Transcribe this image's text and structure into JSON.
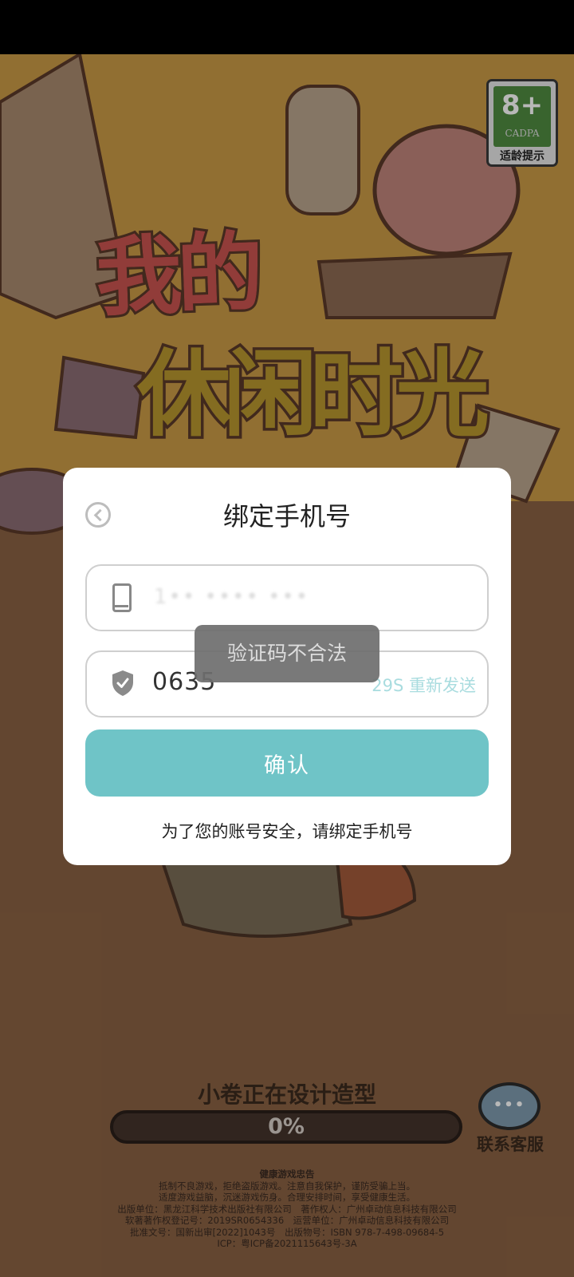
{
  "game": {
    "logo_line1": "我的",
    "logo_line2": "休闲时光",
    "age_rating": {
      "number": "8+",
      "org": "CADPA",
      "tip": "适龄提示"
    },
    "loading_text": "小卷正在设计造型",
    "progress": {
      "label": "0%",
      "value": 0
    },
    "support_label": "联系客服",
    "footer_lines": [
      "健康游戏忠告",
      "抵制不良游戏，拒绝盗版游戏。注意自我保护，谨防受骗上当。",
      "适度游戏益脑，沉迷游戏伤身。合理安排时间，享受健康生活。",
      "出版单位：黑龙江科学技术出版社有限公司　著作权人：广州卓动信息科技有限公司",
      "软著著作权登记号：2019SR0654336　运营单位：广州卓动信息科技有限公司",
      "批准文号：国新出审[2022]1043号　出版物号：ISBN 978-7-498-09684-5",
      "ICP：粤ICP备2021115643号-3A"
    ]
  },
  "dialog": {
    "title": "绑定手机号",
    "phone_value": "1•• •••• •••",
    "code_value": "0635",
    "resend_label": "29S 重新发送",
    "confirm_label": "确认",
    "hint": "为了您的账号安全，请绑定手机号"
  },
  "toast": {
    "message": "验证码不合法"
  },
  "colors": {
    "accent": "#6fc4c7",
    "resend": "#a9dcdf",
    "background": "#8a6243"
  }
}
